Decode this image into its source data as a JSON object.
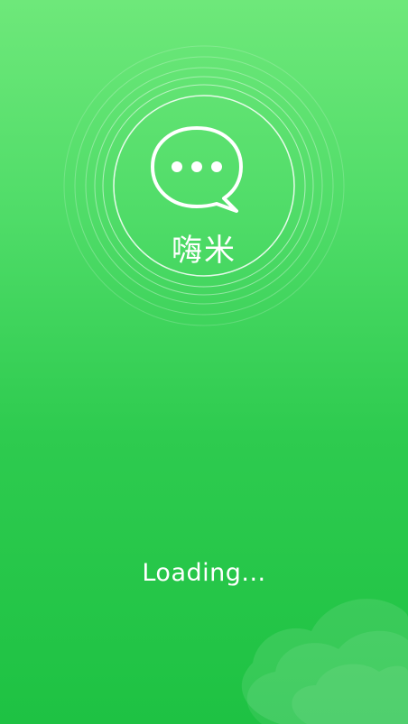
{
  "app": {
    "name": "嗨米",
    "logo_icon": "chat-bubble-ellipsis-icon"
  },
  "splash": {
    "loading_text": "Loading..."
  },
  "colors": {
    "background_top": "#6ee87a",
    "background_bottom": "#1ec243",
    "foreground": "#ffffff"
  }
}
